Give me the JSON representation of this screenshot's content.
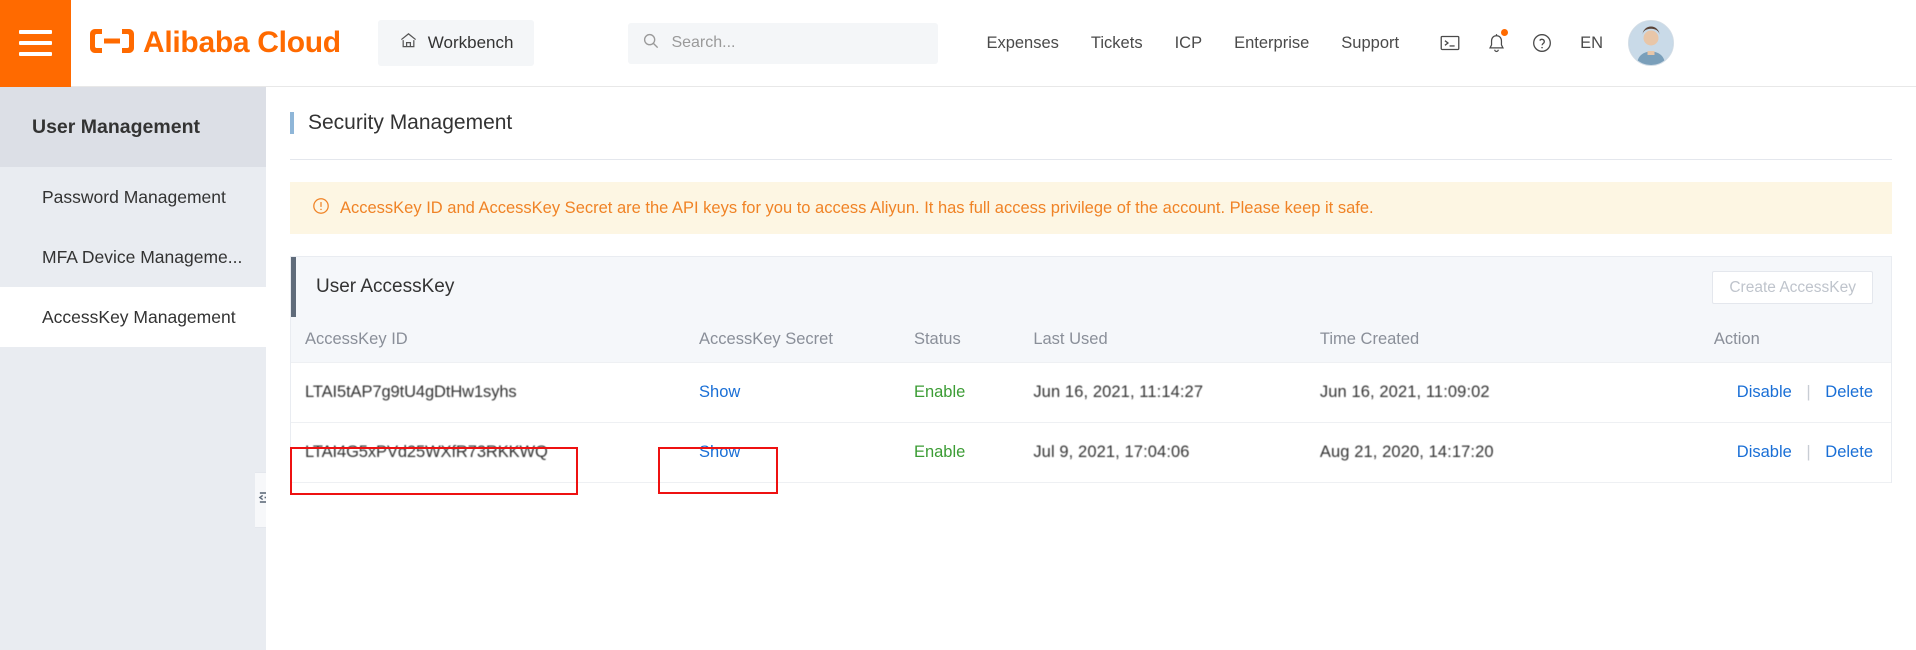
{
  "topnav": {
    "menu_icon": "hamburger-icon",
    "brand": "Alibaba Cloud",
    "workbench": "Workbench",
    "workbench_icon": "home-icon",
    "search": {
      "placeholder": "Search...",
      "value": "",
      "icon": "search-icon"
    },
    "links": [
      "Expenses",
      "Tickets",
      "ICP",
      "Enterprise",
      "Support"
    ],
    "icons": [
      "terminal-icon",
      "bell-icon",
      "help-icon"
    ],
    "language": "EN",
    "avatar": "user-avatar",
    "notification_dot_color": "#ff6a00"
  },
  "sidebar": {
    "title": "User Management",
    "items": [
      {
        "label": "Password Management",
        "selected": false
      },
      {
        "label": "MFA Device Manageme...",
        "selected": false
      },
      {
        "label": "AccessKey Management",
        "selected": true
      }
    ],
    "collapse_icon": "collapse-panel-icon"
  },
  "main": {
    "page_title": "Security Management",
    "alert": {
      "icon": "warning-circle-icon",
      "text": "AccessKey ID and AccessKey Secret are the API keys for you to access Aliyun. It has full access privilege of the account. Please keep it safe.",
      "color": "#f08326",
      "background": "#fdf6e3"
    },
    "panel": {
      "title": "User AccessKey",
      "create_button": {
        "label": "Create AccessKey",
        "disabled": true
      }
    },
    "table": {
      "columns": [
        "AccessKey ID",
        "AccessKey Secret",
        "Status",
        "Last Used",
        "Time Created",
        "Action"
      ],
      "rows": [
        {
          "access_key_id": "LTAI5tAP7g9tU4gDtHw1syhs",
          "secret_label": "Show",
          "status": "Enable",
          "last_used": "Jun 16, 2021, 11:14:27",
          "time_created": "Jun 16, 2021, 11:09:02",
          "actions": [
            "Disable",
            "Delete"
          ],
          "highlighted": false
        },
        {
          "access_key_id": "LTAI4G5xPVd25WXfR73RKKWQ",
          "secret_label": "Show",
          "status": "Enable",
          "last_used": "Jul 9, 2021, 17:04:06",
          "time_created": "Aug 21, 2020, 14:17:20",
          "actions": [
            "Disable",
            "Delete"
          ],
          "highlighted": true
        }
      ]
    }
  },
  "annotations": {
    "accent_color": "#ee1111",
    "boxes": [
      "access-key-id-highlight",
      "show-secret-highlight"
    ]
  }
}
